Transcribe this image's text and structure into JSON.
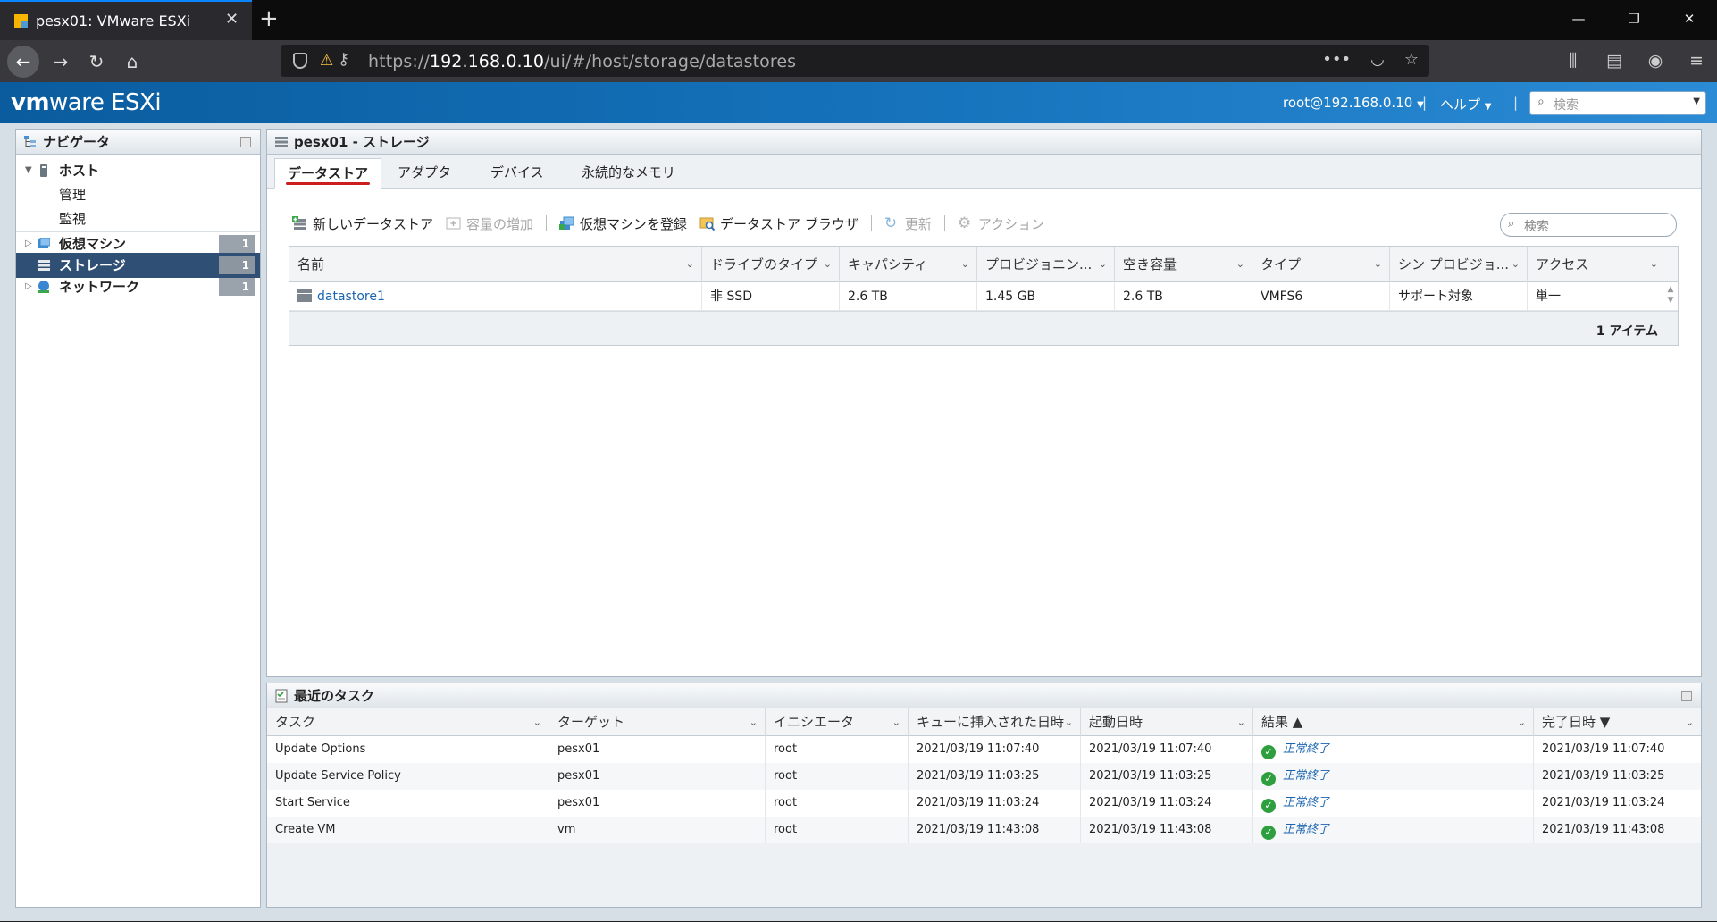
{
  "browser": {
    "tab_title": "pesx01: VMware ESXi",
    "url_prefix": "https://",
    "url_host": "192.168.0.10",
    "url_path": "/ui/#/host/storage/datastores"
  },
  "header": {
    "brand_bold": "vm",
    "brand_rest": "ware",
    "brand_product": "ESXi",
    "user": "root@192.168.0.10",
    "help": "ヘルプ",
    "search_placeholder": "検索"
  },
  "navigator": {
    "title": "ナビゲータ",
    "items": [
      {
        "label": "ホスト"
      },
      {
        "label": "管理"
      },
      {
        "label": "監視"
      },
      {
        "label": "仮想マシン",
        "count": "1"
      },
      {
        "label": "ストレージ",
        "count": "1"
      },
      {
        "label": "ネットワーク",
        "count": "1"
      }
    ]
  },
  "main": {
    "title": "pesx01 - ストレージ",
    "tabs": [
      {
        "label": "データストア"
      },
      {
        "label": "アダプタ"
      },
      {
        "label": "デバイス"
      },
      {
        "label": "永続的なメモリ"
      }
    ],
    "toolbar": {
      "new_datastore": "新しいデータストア",
      "increase_capacity": "容量の増加",
      "register_vm": "仮想マシンを登録",
      "datastore_browser": "データストア ブラウザ",
      "refresh": "更新",
      "actions": "アクション"
    },
    "search_placeholder": "検索",
    "columns": [
      "名前",
      "ドライブのタイプ",
      "キャパシティ",
      "プロビジョニン...",
      "空き容量",
      "タイプ",
      "シン プロビジョ...",
      "アクセス"
    ],
    "rows": [
      [
        "datastore1",
        "非 SSD",
        "2.6 TB",
        "1.45 GB",
        "2.6 TB",
        "VMFS6",
        "サポート対象",
        "単一"
      ]
    ],
    "footer": "1 アイテム"
  },
  "tasks": {
    "title": "最近のタスク",
    "columns": [
      "タスク",
      "ターゲット",
      "イニシエータ",
      "キューに挿入された日時",
      "起動日時",
      "結果 ▲",
      "完了日時 ▼"
    ],
    "rows": [
      [
        "Update Options",
        "pesx01",
        "root",
        "2021/03/19 11:07:40",
        "2021/03/19 11:07:40",
        "正常終了",
        "2021/03/19 11:07:40"
      ],
      [
        "Update Service Policy",
        "pesx01",
        "root",
        "2021/03/19 11:03:25",
        "2021/03/19 11:03:25",
        "正常終了",
        "2021/03/19 11:03:25"
      ],
      [
        "Start Service",
        "pesx01",
        "root",
        "2021/03/19 11:03:24",
        "2021/03/19 11:03:24",
        "正常終了",
        "2021/03/19 11:03:24"
      ],
      [
        "Create VM",
        "vm",
        "root",
        "2021/03/19 11:43:08",
        "2021/03/19 11:43:08",
        "正常終了",
        "2021/03/19 11:43:08"
      ]
    ]
  },
  "colors": {
    "header_blue": "#1674bd",
    "nav_selected": "#2f4f75",
    "tab_underline": "#cc1e1e",
    "success": "#2e9f3e",
    "link": "#1a64b0"
  }
}
